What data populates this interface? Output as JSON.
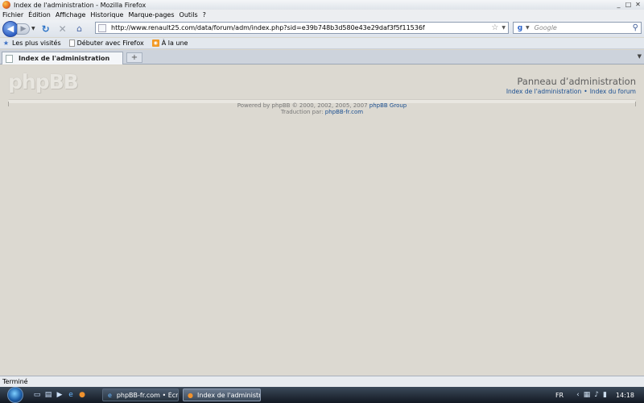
{
  "window": {
    "title": "Index de l'administration - Mozilla Firefox",
    "buttons": [
      "_",
      "□",
      "✕"
    ]
  },
  "menu": [
    "Fichier",
    "Édition",
    "Affichage",
    "Historique",
    "Marque-pages",
    "Outils",
    "?"
  ],
  "nav": {
    "url": "http://www.renault25.com/data/forum/adm/index.php?sid=e39b748b3d580e43e29daf3f5f11536f",
    "search_placeholder": "Google",
    "search_engine_glyph": "g"
  },
  "bookmarks": [
    {
      "label": "Les plus visités",
      "icon": "star-icon"
    },
    {
      "label": "Débuter avec Firefox",
      "icon": "page-icon"
    },
    {
      "label": "À la une",
      "icon": "rss-icon"
    }
  ],
  "tabs": [
    {
      "label": "Index de l'administration",
      "active": true
    }
  ],
  "page": {
    "logo": "phpBB",
    "admin_title": "Panneau d’administration",
    "link_index_admin": "Index de l'administration",
    "link_separator": "•",
    "link_index_forum": "Index du forum",
    "powered_by": "Powered by phpBB © 2000, 2002, 2005, 2007",
    "phpbb_group": "phpBB Group",
    "translation_label": "Traduction par:",
    "translation_link": "phpBB-fr.com"
  },
  "status": "Terminé",
  "taskbar": {
    "tasks": [
      {
        "label": "phpBB-fr.com • Écri...",
        "icon": "ie-icon"
      },
      {
        "label": "Index de l'administr...",
        "icon": "firefox-icon"
      }
    ],
    "lang": "FR",
    "time": "14:18"
  },
  "colors": {
    "page_bg": "#dcd9d1",
    "link": "#1b4f91"
  }
}
